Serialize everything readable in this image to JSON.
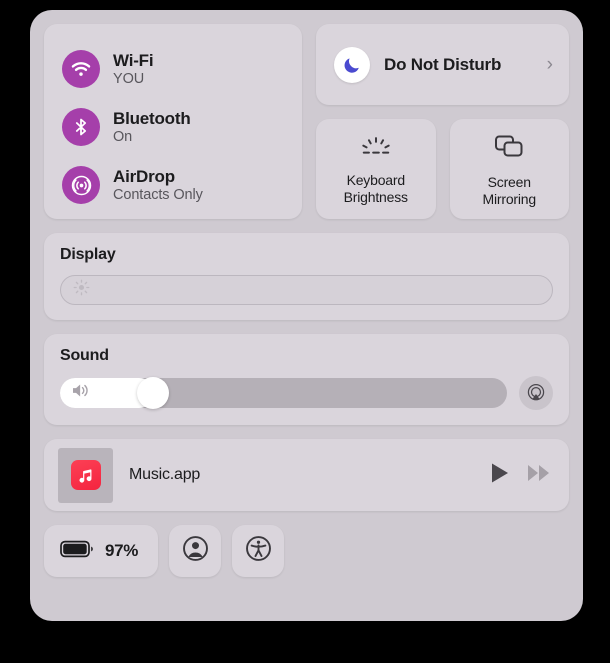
{
  "window": {
    "title": "Control Center",
    "background_color": "#000000",
    "panel_color": "#cfcad1",
    "card_color": "#dad5dc"
  },
  "connectivity": {
    "accent_color": "#a53faa",
    "items": [
      {
        "icon": "wifi-icon",
        "title": "Wi-Fi",
        "status": "YOU"
      },
      {
        "icon": "bluetooth-icon",
        "title": "Bluetooth",
        "status": "On"
      },
      {
        "icon": "airdrop-icon",
        "title": "AirDrop",
        "status": "Contacts Only"
      }
    ]
  },
  "do_not_disturb": {
    "icon": "moon-icon",
    "label": "Do Not Disturb",
    "chevron": "›",
    "moon_color": "#4a4ad0",
    "enabled": false
  },
  "tiles": [
    {
      "icon": "keyboard-brightness-icon",
      "line1": "Keyboard",
      "line2": "Brightness"
    },
    {
      "icon": "screen-mirroring-icon",
      "line1": "Screen",
      "line2": "Mirroring"
    }
  ],
  "display": {
    "heading": "Display",
    "icon": "brightness-sun-icon",
    "value_percent": 0
  },
  "sound": {
    "heading": "Sound",
    "icon": "speaker-icon",
    "value_percent": 21,
    "output_icon": "airplay-audio-icon"
  },
  "now_playing": {
    "app_icon": "music-app-icon",
    "app_name": "Music.app",
    "play_button": "play-icon",
    "forward_button": "fast-forward-icon"
  },
  "bottom_bar": {
    "battery": {
      "icon": "battery-icon",
      "percent_label": "97%",
      "level": 97
    },
    "buttons": [
      {
        "icon": "user-account-icon"
      },
      {
        "icon": "accessibility-icon"
      }
    ]
  }
}
